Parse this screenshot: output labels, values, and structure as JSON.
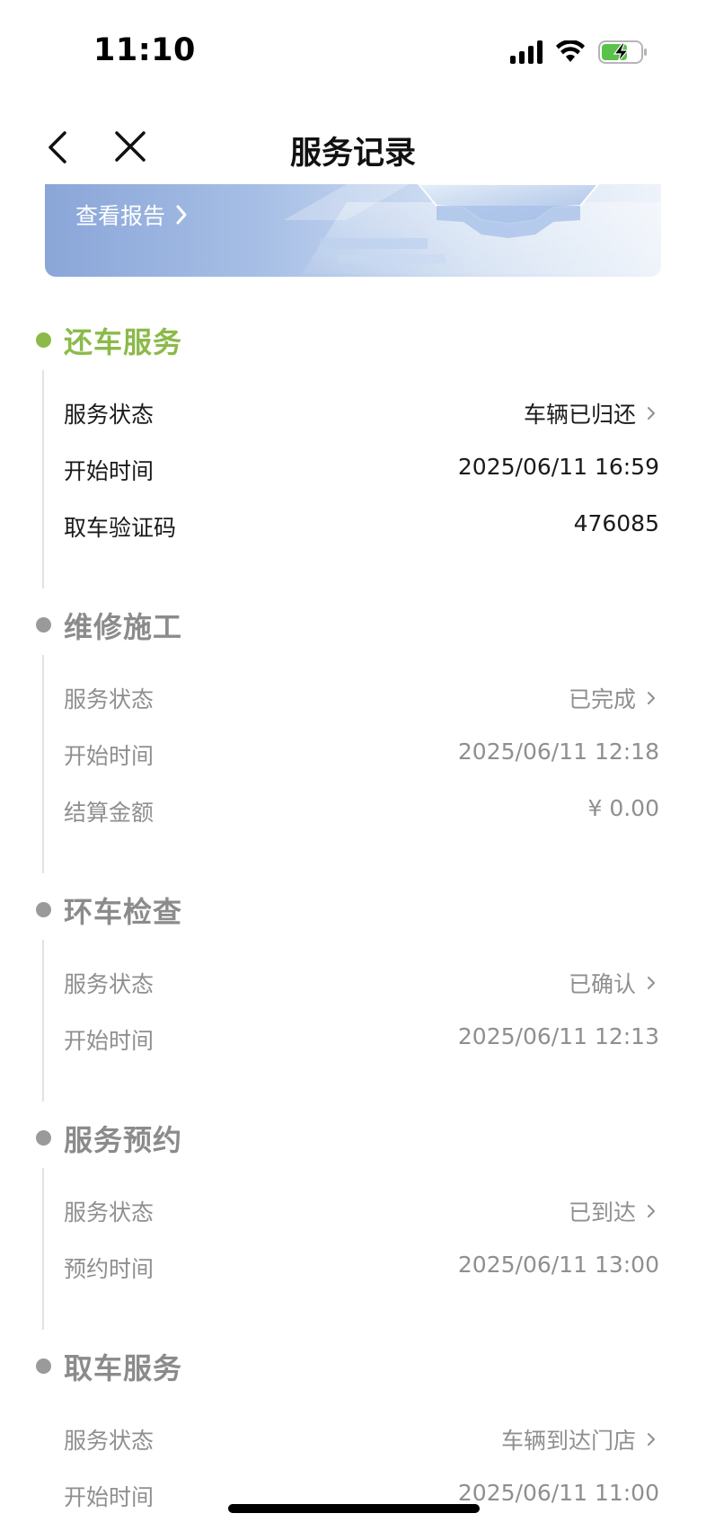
{
  "status_bar": {
    "time": "11:10"
  },
  "nav": {
    "title": "服务记录"
  },
  "banner": {
    "link_label": "查看报告"
  },
  "sections": [
    {
      "title": "还车服务",
      "active": true,
      "rows": [
        {
          "label": "服务状态",
          "value": "车辆已归还",
          "chevron": true
        },
        {
          "label": "开始时间",
          "value": "2025/06/11 16:59",
          "chevron": false
        },
        {
          "label": "取车验证码",
          "value": "476085",
          "chevron": false
        }
      ]
    },
    {
      "title": "维修施工",
      "active": false,
      "rows": [
        {
          "label": "服务状态",
          "value": "已完成",
          "chevron": true
        },
        {
          "label": "开始时间",
          "value": "2025/06/11 12:18",
          "chevron": false
        },
        {
          "label": "结算金额",
          "value": "¥  0.00",
          "chevron": false
        }
      ]
    },
    {
      "title": "环车检查",
      "active": false,
      "rows": [
        {
          "label": "服务状态",
          "value": "已确认",
          "chevron": true
        },
        {
          "label": "开始时间",
          "value": "2025/06/11 12:13",
          "chevron": false
        }
      ]
    },
    {
      "title": "服务预约",
      "active": false,
      "rows": [
        {
          "label": "服务状态",
          "value": "已到达",
          "chevron": true
        },
        {
          "label": "预约时间",
          "value": "2025/06/11 13:00",
          "chevron": false
        }
      ]
    },
    {
      "title": "取车服务",
      "active": false,
      "rows": [
        {
          "label": "服务状态",
          "value": "车辆到达门店",
          "chevron": true
        },
        {
          "label": "开始时间",
          "value": "2025/06/11 11:00",
          "chevron": false
        }
      ]
    }
  ],
  "colors": {
    "accent_green": "#8cba4a",
    "muted_gray": "#8f8f8f",
    "banner_blue": "#8aa6d8"
  },
  "icons": [
    "cellular-signal-icon",
    "wifi-icon",
    "battery-charging-icon",
    "back-arrow-icon",
    "close-icon",
    "chevron-right-icon"
  ]
}
